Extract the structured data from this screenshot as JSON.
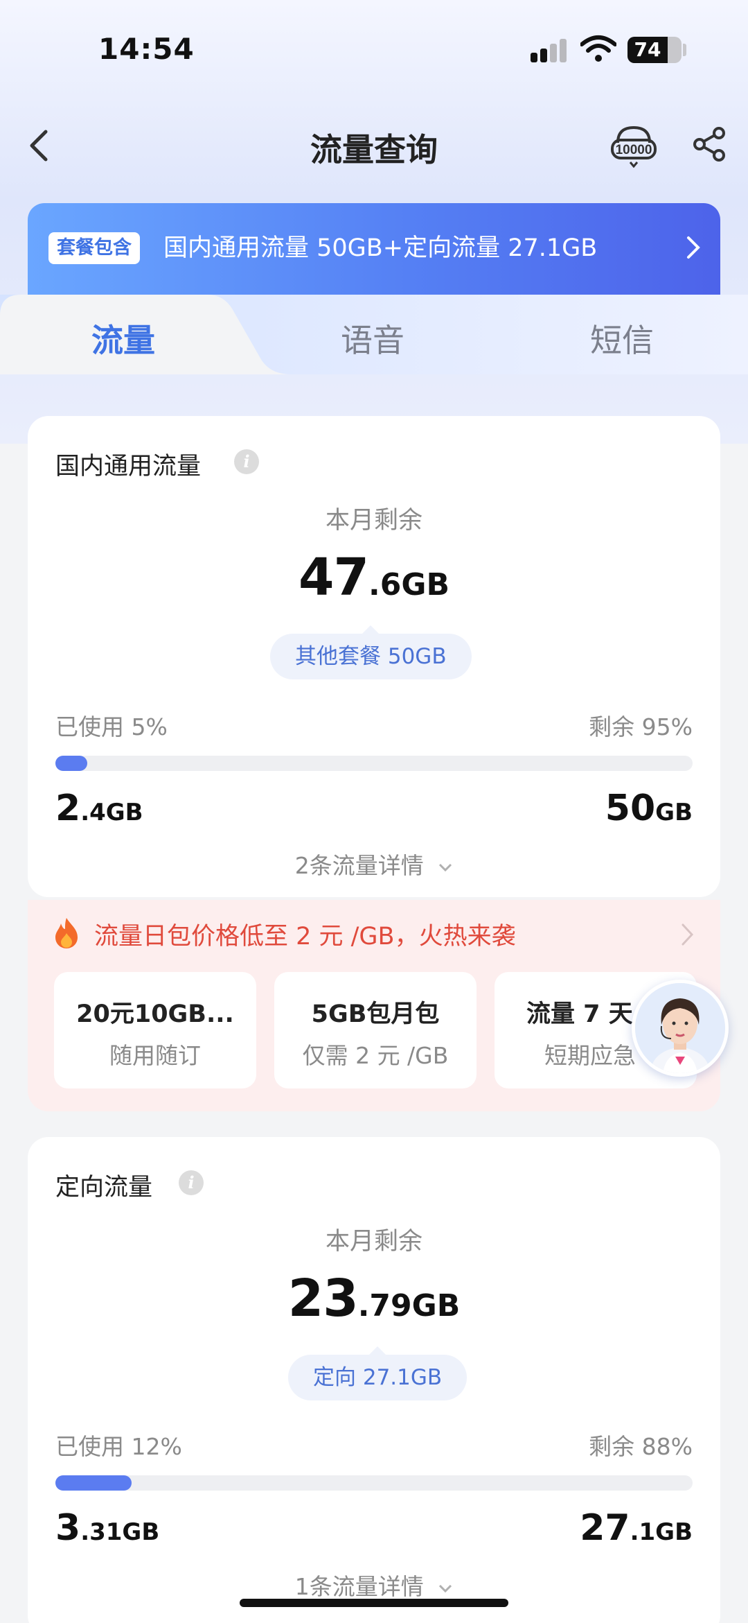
{
  "status_bar": {
    "time": "14:54",
    "battery": "74",
    "battery_level": 0.74
  },
  "nav": {
    "title": "流量查询",
    "service_icon_label": "10000"
  },
  "banner": {
    "badge": "套餐包含",
    "text": "国内通用流量 50GB+定向流量 27.1GB"
  },
  "tabs": [
    {
      "label": "流量",
      "active": true
    },
    {
      "label": "语音",
      "active": false
    },
    {
      "label": "短信",
      "active": false
    }
  ],
  "domestic": {
    "title": "国内通用流量",
    "remain_label": "本月剩余",
    "remain_big": "47",
    "remain_small": ".6GB",
    "pill": "其他套餐 50GB",
    "used_label": "已使用 5%",
    "rest_label": "剩余 95%",
    "used_fraction": 0.05,
    "used_big": "2",
    "used_small": ".4GB",
    "total_big": "50",
    "total_small": "GB",
    "detail": "2条流量详情"
  },
  "promo": {
    "text": "流量日包价格低至 2 元 /GB，火热来袭",
    "accent_color": "#e04a3c",
    "items": [
      {
        "title": "20元10GB...",
        "sub": "随用随订"
      },
      {
        "title": "5GB包月包",
        "sub": "仅需 2 元 /GB"
      },
      {
        "title": "流量 7 天",
        "sub": "短期应急"
      }
    ]
  },
  "directed": {
    "title": "定向流量",
    "remain_label": "本月剩余",
    "remain_big": "23",
    "remain_small": ".79GB",
    "pill": "定向 27.1GB",
    "used_label": "已使用 12%",
    "rest_label": "剩余 88%",
    "used_fraction": 0.12,
    "used_big": "3",
    "used_small": ".31GB",
    "total_big": "27",
    "total_small": ".1GB",
    "detail": "1条流量详情"
  },
  "colors": {
    "accent": "#3f73e4",
    "bar": "#5b7cf0"
  }
}
